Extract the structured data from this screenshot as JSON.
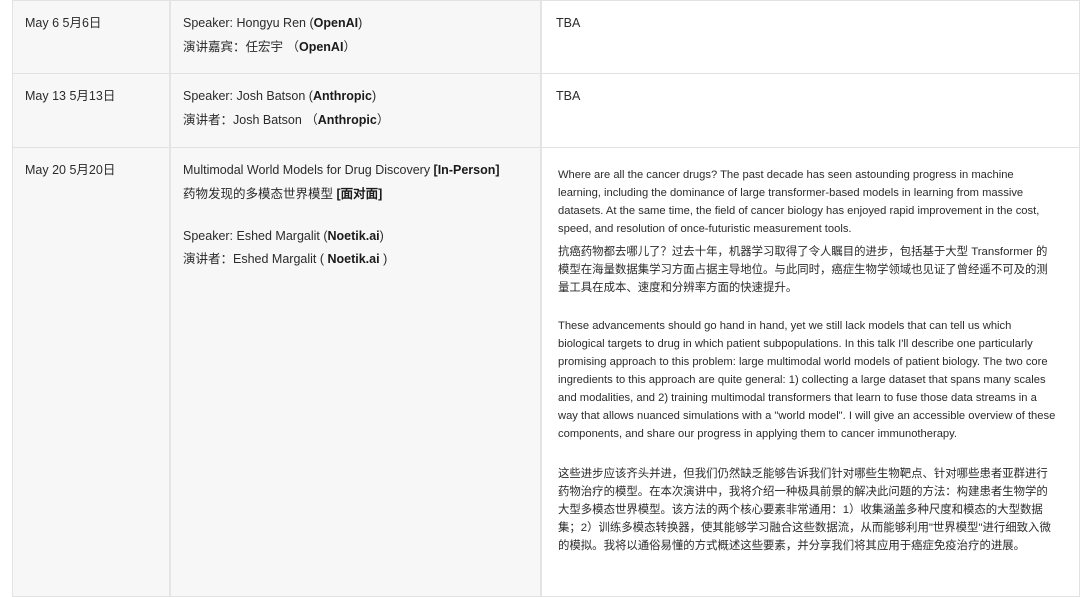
{
  "rows": [
    {
      "date": "May 6  5月6日",
      "speaker_en_prefix": "Speaker: Hongyu Ren (",
      "speaker_en_org": "OpenAI",
      "speaker_en_suffix": ")",
      "speaker_zh_prefix": "演讲嘉宾：任宏宇 （",
      "speaker_zh_org": "OpenAI",
      "speaker_zh_suffix": "）",
      "abstract": "TBA"
    },
    {
      "date": "May 13  5月13日",
      "speaker_en_prefix": "Speaker: Josh Batson (",
      "speaker_en_org": "Anthropic",
      "speaker_en_suffix": ")",
      "speaker_zh_prefix": "演讲者：Josh Batson （",
      "speaker_zh_org": "Anthropic",
      "speaker_zh_suffix": "）",
      "abstract": "TBA"
    },
    {
      "date": "May 20  5月20日",
      "title_en": "Multimodal World Models for Drug Discovery ",
      "title_en_tag": "[In-Person]",
      "title_zh": "药物发现的多模态世界模型 ",
      "title_zh_tag": "[面对面]",
      "speaker_en_prefix": "Speaker: Eshed Margalit (",
      "speaker_en_org": "Noetik.ai",
      "speaker_en_suffix": ")",
      "speaker_zh_prefix": "演讲者：Eshed Margalit ( ",
      "speaker_zh_org": "Noetik.ai",
      "speaker_zh_suffix": " )",
      "abstract_p1_en": "Where are all the cancer drugs? The past decade has seen astounding progress in machine learning, including the dominance of large transformer-based models in learning from massive datasets. At the same time, the field of cancer biology has enjoyed rapid improvement in the cost, speed, and resolution of once-futuristic measurement tools.",
      "abstract_p1_zh": "抗癌药物都去哪儿了？过去十年，机器学习取得了令人瞩目的进步，包括基于大型 Transformer 的模型在海量数据集学习方面占据主导地位。与此同时，癌症生物学领域也见证了曾经遥不可及的测量工具在成本、速度和分辨率方面的快速提升。",
      "abstract_p2_en": "These advancements should go hand in hand, yet we still lack models that can tell us which biological targets to drug in which patient subpopulations. In this talk I'll describe one particularly promising approach to this problem: large multimodal world models of patient biology. The two core ingredients to this approach are quite general: 1) collecting a large dataset that spans many scales and modalities, and 2) training multimodal transformers that learn to fuse those data streams in a way that allows nuanced simulations with a \"world model\". I will give an accessible overview of these components, and share our progress in applying them to cancer immunotherapy.",
      "abstract_p2_zh": "这些进步应该齐头并进，但我们仍然缺乏能够告诉我们针对哪些生物靶点、针对哪些患者亚群进行药物治疗的模型。在本次演讲中，我将介绍一种极具前景的解决此问题的方法：构建患者生物学的大型多模态世界模型。该方法的两个核心要素非常通用：1）收集涵盖多种尺度和模态的大型数据集；2）训练多模态转换器，使其能够学习融合这些数据流，从而能够利用\"世界模型\"进行细致入微的模拟。我将以通俗易懂的方式概述这些要素，并分享我们将其应用于癌症免疫治疗的进展。"
    }
  ]
}
